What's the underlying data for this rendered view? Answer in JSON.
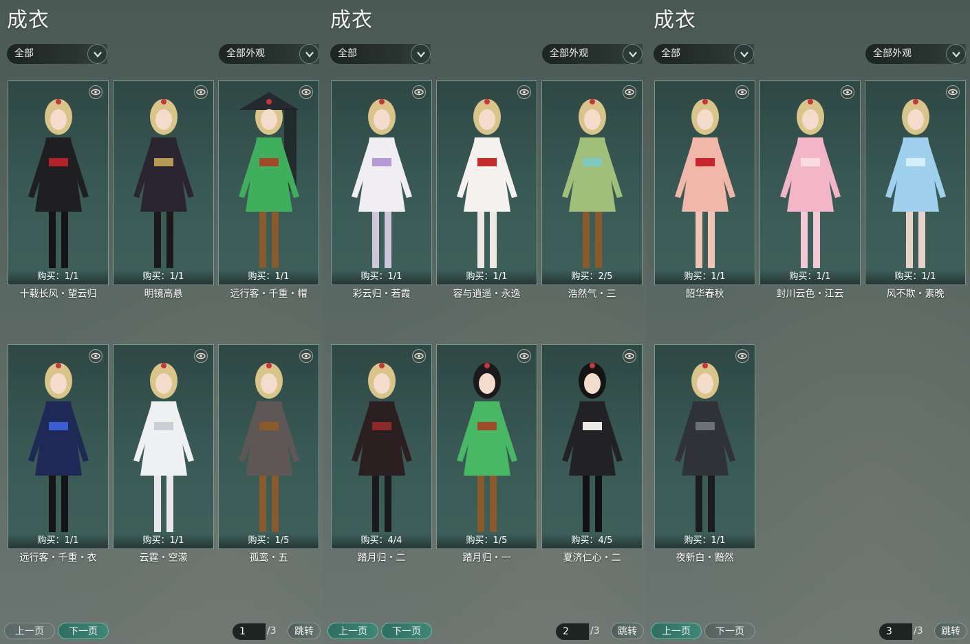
{
  "panels": [
    {
      "title": "成衣",
      "filter_left": "全部",
      "filter_right": "全部外观",
      "items": [
        {
          "buy": "购买：1/1",
          "name": "十载长风・望云归",
          "palette": "black-red"
        },
        {
          "buy": "购买：1/1",
          "name": "明镜高悬",
          "palette": "black-gold"
        },
        {
          "buy": "购买：1/1",
          "name": "远行客・千重・帽",
          "palette": "green-hat"
        },
        {
          "buy": "购买：1/1",
          "name": "远行客・千重・衣",
          "palette": "navy-blue"
        },
        {
          "buy": "购买：1/1",
          "name": "云霆・空濛",
          "palette": "white"
        },
        {
          "buy": "购买：1/5",
          "name": "孤鸾・五",
          "palette": "grey-brown"
        }
      ],
      "pagination": {
        "prev": "上一页",
        "next": "下一页",
        "current": "1",
        "total": "/3",
        "jump": "跳转"
      }
    },
    {
      "title": "成衣",
      "filter_left": "全部",
      "filter_right": "全部外观",
      "items": [
        {
          "buy": "购买：1/1",
          "name": "彩云归・若霞",
          "palette": "lavender"
        },
        {
          "buy": "购买：1/1",
          "name": "容与逍遥・永逸",
          "palette": "white-red"
        },
        {
          "buy": "购买：2/5",
          "name": "浩然气・三",
          "palette": "green-light"
        },
        {
          "buy": "购买：4/4",
          "name": "踏月归・二",
          "palette": "black-crimson"
        },
        {
          "buy": "购买：1/5",
          "name": "踏月归・一",
          "palette": "green"
        },
        {
          "buy": "购买：4/5",
          "name": "夏济仁心・二",
          "palette": "black-white"
        }
      ],
      "pagination": {
        "prev": "上一页",
        "next": "下一页",
        "current": "2",
        "total": "/3",
        "jump": "跳转"
      }
    },
    {
      "title": "成衣",
      "filter_left": "全部",
      "filter_right": "全部外观",
      "items": [
        {
          "buy": "购买：1/1",
          "name": "韶华春秋",
          "palette": "peach"
        },
        {
          "buy": "购买：1/1",
          "name": "封川云色・江云",
          "palette": "pink"
        },
        {
          "buy": "购买：1/1",
          "name": "风不欺・素晚",
          "palette": "sky-blue"
        },
        {
          "buy": "购买：1/1",
          "name": "夜新白・黯然",
          "palette": "dark-grey"
        }
      ],
      "pagination": {
        "prev": "上一页",
        "next": "下一页",
        "current": "3",
        "total": "/3",
        "jump": "跳转"
      }
    }
  ],
  "colors": {
    "card_bg": "#3a5a55",
    "card_border": "#7f9791",
    "next_active": "#3f8677",
    "dropdown_bg": "#1d2523"
  },
  "icons": {
    "preview": "eye-icon",
    "dropdown": "chevron-down-icon"
  }
}
